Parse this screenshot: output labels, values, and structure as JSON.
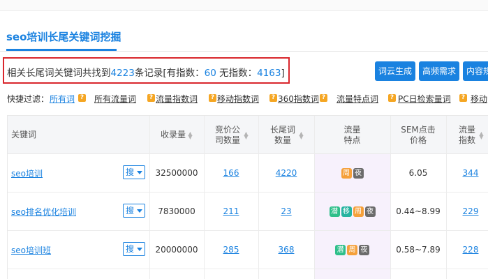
{
  "tab": {
    "keyword": "seo培训",
    "title_rest": "长尾关键词挖掘"
  },
  "summary": {
    "prefix": "相关长尾词关键词共找到",
    "total": "4223",
    "mid1": "条记录[有指数：",
    "with_index": "60",
    "mid2": " 无指数：",
    "without_index": "4163",
    "suffix": "]"
  },
  "buttons": {
    "wordcloud": "词云生成",
    "high_freq": "高频需求",
    "content": "内容规"
  },
  "filters": {
    "label": "快捷过滤：",
    "items": [
      "所有词",
      "所有流量词",
      "流量指数词",
      "移动指数词",
      "360指数词",
      "流量特点词",
      "PC日检索量词",
      "移动"
    ]
  },
  "table": {
    "headers": {
      "keyword": "关键词",
      "indexed": "收录量",
      "bid_companies": "竞价公司数量",
      "long_tail": "长尾词数量",
      "traffic_features": "流量特点",
      "sem_price": "SEM点击价格",
      "traffic_index": "流量指数"
    },
    "search_label": "搜",
    "rows": [
      {
        "keyword_prefix": "seo",
        "keyword_mid": "培训",
        "keyword_suffix": "",
        "indexed": "32500000",
        "bid_companies": "166",
        "long_tail": "4220",
        "tags": [
          "周",
          "夜"
        ],
        "sem_price": "6.05",
        "traffic_index": "344"
      },
      {
        "keyword_prefix": "seo排名优化",
        "keyword_mid": "培训",
        "keyword_suffix": "",
        "indexed": "7830000",
        "bid_companies": "211",
        "long_tail": "23",
        "tags": [
          "潜",
          "移",
          "周",
          "夜"
        ],
        "sem_price": "0.44~8.99",
        "traffic_index": "229"
      },
      {
        "keyword_prefix": "seo",
        "keyword_mid": "培训",
        "keyword_suffix": "班",
        "indexed": "20000000",
        "bid_companies": "285",
        "long_tail": "368",
        "tags": [
          "潜",
          "周",
          "夜"
        ],
        "sem_price": "0.58~7.89",
        "traffic_index": "228"
      }
    ]
  },
  "tag_colors": {
    "周": "#f5a03a",
    "夜": "#6b6b6b",
    "潜": "#2fbf8a",
    "移": "#26b3a0"
  },
  "accent_color": "#1a82e0",
  "highlight_border": "#d9262c"
}
